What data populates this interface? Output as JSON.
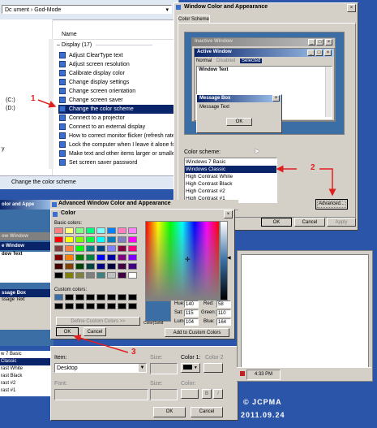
{
  "explorer": {
    "address": "ument › God-Mode",
    "column_header": "Name",
    "group": "Display (17)",
    "items": [
      "Adjust ClearType text",
      "Adjust screen resolution",
      "Calibrate display color",
      "Change display settings",
      "Change screen orientation",
      "Change screen saver",
      "Change the color scheme",
      "Connect to a projector",
      "Connect to an external display",
      "How to correct monitor flicker (refresh rate)",
      "Lock the computer when I leave it alone for a",
      "Make text and other items larger or smaller",
      "Set screen saver password"
    ],
    "side_c": "(C:)",
    "side_d": "(D:)",
    "status": "Change the color scheme"
  },
  "wca": {
    "title": "Window Color and Appearance",
    "tab": "Color Scheme",
    "inactive": "Inactive Window",
    "active": "Active Window",
    "menu": [
      "Normal",
      "Disabled",
      "Selected"
    ],
    "window_text": "Window Text",
    "message_box": "Message Box",
    "message_text": "Message Text",
    "ok": "OK",
    "scheme_label": "Color scheme:",
    "schemes": [
      "Windows 7 Basic",
      "Windows Classic",
      "High Contrast White",
      "High Contrast Black",
      "High Contrast #2",
      "High Contrast #1"
    ],
    "advanced": "Advanced...",
    "apply": "Apply",
    "cancel": "Cancel"
  },
  "advanced": {
    "title": "Advanced Window Color and Appearance",
    "left_prev": [
      "olor and Appe",
      "ow Window",
      "e Window",
      "dow Text",
      "ssage Box",
      "ssage Text"
    ],
    "scheme_list": [
      "w 7 Basic",
      "Classic",
      "rast White",
      "rast Black",
      "rast #2",
      "rast #1"
    ],
    "item_label": "Item:",
    "item_value": "Desktop",
    "size_label": "Size:",
    "color1_label": "Color 1:",
    "color2_label": "Color 2",
    "font_label": "Font:",
    "size2_label": "Size:",
    "color_label": "Color:",
    "bold": "B",
    "italic": "I",
    "ok": "OK",
    "cancel": "Cancel"
  },
  "color_dialog": {
    "title": "Color",
    "basic_label": "Basic colors:",
    "custom_label": "Custom colors:",
    "define": "Define Custom Colors >>",
    "ok": "OK",
    "cancel": "Cancel",
    "color_solid": "Color|Solid",
    "hue_label": "Hue:",
    "hue": "140",
    "sat_label": "Sat:",
    "sat": "115",
    "lum_label": "Lum:",
    "lum": "104",
    "red_label": "Red:",
    "red": "58",
    "green_label": "Green:",
    "green": "110",
    "blue_label": "Blue:",
    "blue": "164",
    "add": "Add to Custom Colors",
    "basic_colors": [
      "#ff8080",
      "#ffff80",
      "#80ff80",
      "#00ff80",
      "#80ffff",
      "#0080ff",
      "#ff80c0",
      "#ff80ff",
      "#ff0000",
      "#ffff00",
      "#80ff00",
      "#00ff40",
      "#00ffff",
      "#0080c0",
      "#8080c0",
      "#ff00ff",
      "#804040",
      "#ff8040",
      "#00ff00",
      "#008080",
      "#004080",
      "#8080ff",
      "#800040",
      "#ff0080",
      "#800000",
      "#ff8000",
      "#008000",
      "#008040",
      "#0000ff",
      "#0000a0",
      "#800080",
      "#8000ff",
      "#400000",
      "#804000",
      "#004000",
      "#004040",
      "#000080",
      "#000040",
      "#400040",
      "#400080",
      "#000000",
      "#808000",
      "#808040",
      "#808080",
      "#408080",
      "#c0c0c0",
      "#400040",
      "#ffffff"
    ],
    "custom_first": "#3a6ea4"
  },
  "taskbar_time": "4:33 PM",
  "annotations": {
    "one": "1",
    "two": "2",
    "three": "3"
  },
  "watermark": {
    "brand": "© JCPMA",
    "date": "2011.09.24"
  },
  "colors": {
    "desktop": "#2b55a8",
    "selection": "#0a246a",
    "arrow": "#e02020"
  }
}
